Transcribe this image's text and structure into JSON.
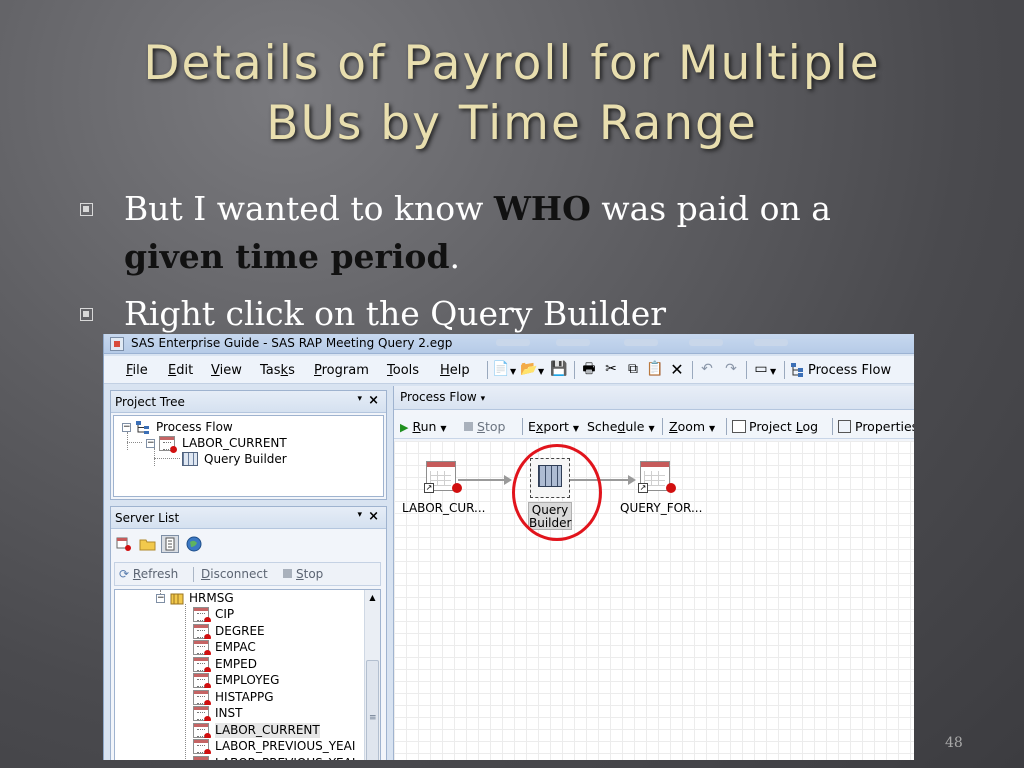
{
  "slide": {
    "title_line1": "Details of Payroll for Multiple",
    "title_line2": "BUs by Time Range",
    "bullets": [
      {
        "parts": [
          "But I wanted to know ",
          "WHO",
          " was paid on a"
        ]
      },
      {
        "parts": [
          "given time period",
          "."
        ]
      },
      {
        "parts": [
          "Right click on the Query Builder"
        ]
      }
    ],
    "page_number": "48"
  },
  "window": {
    "title": "SAS Enterprise Guide - SAS RAP Meeting Query 2.egp",
    "menu": [
      {
        "u": "F",
        "rest": "ile"
      },
      {
        "u": "E",
        "rest": "dit"
      },
      {
        "u": "V",
        "rest": "iew"
      },
      {
        "pre": "Tas",
        "u": "k",
        "rest": "s"
      },
      {
        "u": "P",
        "rest": "rogram"
      },
      {
        "u": "T",
        "rest": "ools"
      },
      {
        "u": "H",
        "rest": "elp"
      }
    ],
    "toolbar_process_flow_label": "Process Flow"
  },
  "project_tree": {
    "title": "Project Tree",
    "pin": "▾",
    "close": "×",
    "items": [
      {
        "label": "Process Flow",
        "icon": "process-flow-icon"
      },
      {
        "label": "LABOR_CURRENT",
        "icon": "table-icon"
      },
      {
        "label": "Query Builder",
        "icon": "query-builder-icon"
      }
    ]
  },
  "server_list": {
    "title": "Server List",
    "pin": "▾",
    "close": "×",
    "actions": {
      "refresh_u": "R",
      "refresh_rest": "efresh",
      "disconnect_u": "D",
      "disconnect_rest": "isconnect",
      "stop_u": "S",
      "stop_rest": "top"
    },
    "library": "HRMSG",
    "tables": [
      "CIP",
      "DEGREE",
      "EMPAC",
      "EMPED",
      "EMPLOYEG",
      "HISTAPPG",
      "INST",
      "LABOR_CURRENT",
      "LABOR_PREVIOUS_YEAI",
      "LABOR_PREVIOUS_YEAI"
    ]
  },
  "process_flow": {
    "tab": "Process Flow",
    "toolbar": {
      "run_u": "R",
      "run_rest": "un",
      "stop_u": "S",
      "stop_rest": "top",
      "export_pre": "E",
      "export_u": "x",
      "export_rest": "port",
      "schedule_pre": "Sche",
      "schedule_u": "d",
      "schedule_rest": "ule",
      "zoom_u": "Z",
      "zoom_rest": "oom",
      "project_log_pre": "Project ",
      "project_log_u": "L",
      "project_log_rest": "og",
      "properties": "Properties"
    },
    "nodes": {
      "source": "LABOR_CUR...",
      "query_line1": "Query",
      "query_line2": "Builder",
      "output": "QUERY_FOR..."
    }
  },
  "colors": {
    "title": "#e9dfaf",
    "highlight": "#e1141c",
    "table_header": "#c65b5b",
    "status_dot": "#d10f0f"
  }
}
